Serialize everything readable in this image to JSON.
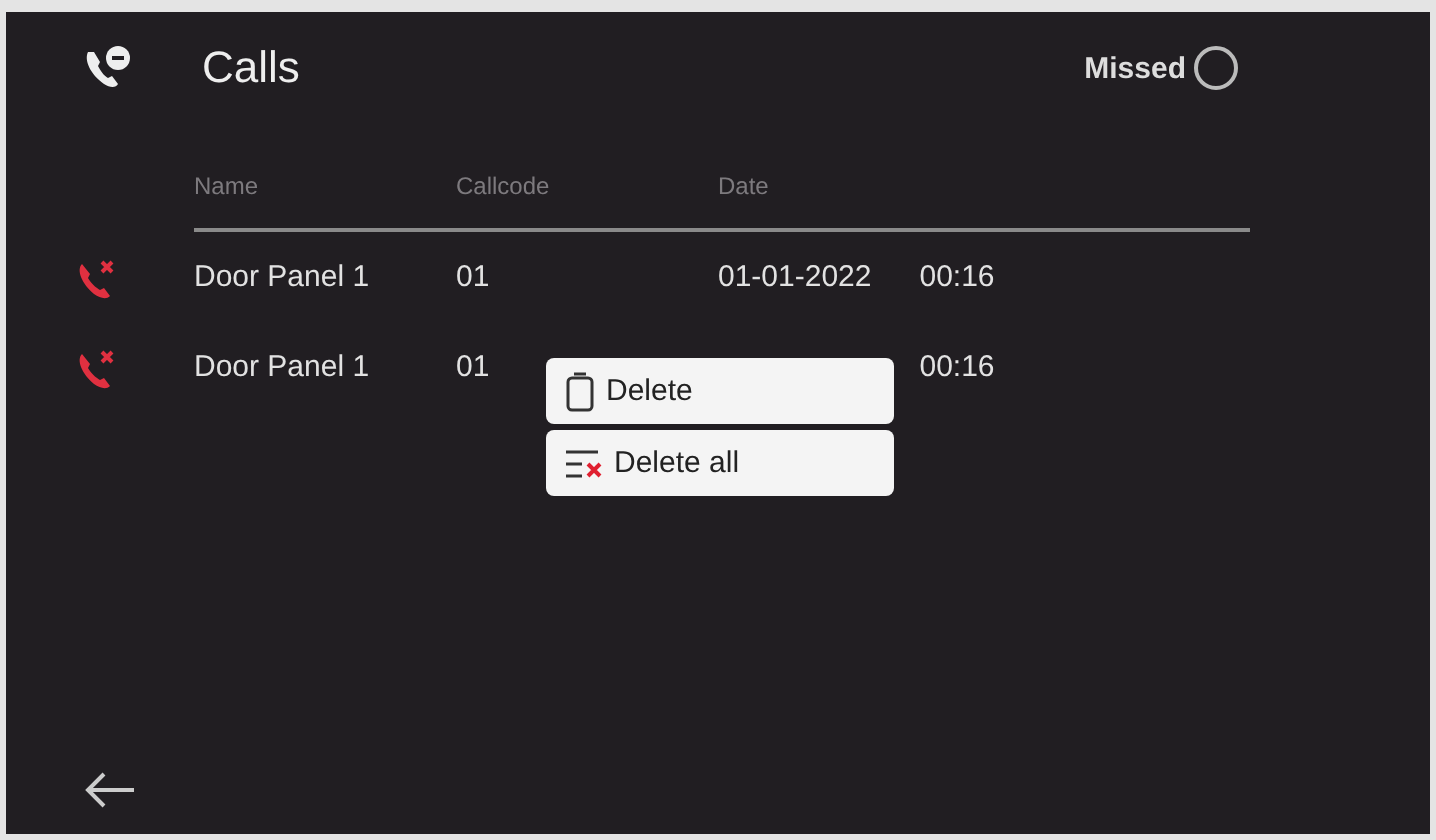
{
  "header": {
    "title": "Calls",
    "filter": {
      "label": "Missed",
      "checked": false
    }
  },
  "table": {
    "columns": [
      "Name",
      "Callcode",
      "Date"
    ],
    "rows": [
      {
        "kind": "missed",
        "name": "Door Panel 1",
        "callcode": "01",
        "date": "01-01-2022",
        "time": "00:16"
      },
      {
        "kind": "missed",
        "name": "Door Panel 1",
        "callcode": "01",
        "time": "00:16"
      }
    ]
  },
  "context_menu": [
    {
      "kind": "delete",
      "label": "Delete"
    },
    {
      "kind": "delete_all",
      "label": "Delete all"
    }
  ]
}
